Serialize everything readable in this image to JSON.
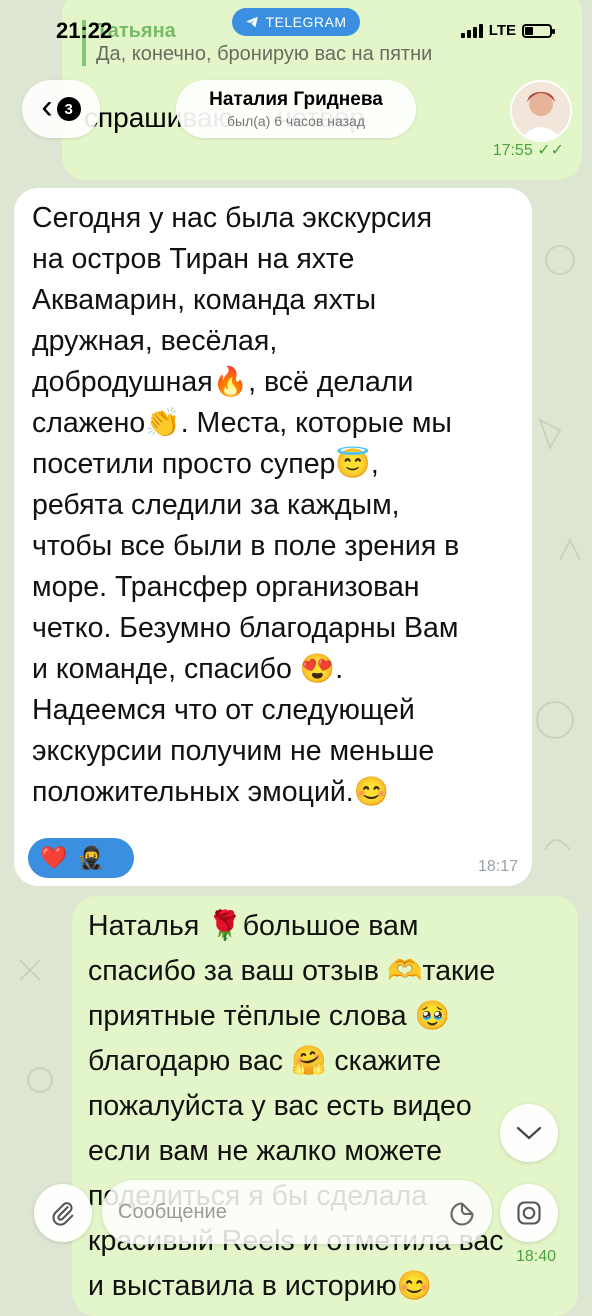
{
  "status_bar": {
    "time": "21:22",
    "app_pill": "TELEGRAM",
    "network": "LTE",
    "battery_level": 0.3
  },
  "header": {
    "back_badge": "3",
    "contact_name": "Наталия Гриднева",
    "contact_status": "был(а) 6 часов назад"
  },
  "previous_message": {
    "reply_name": "Татьяна",
    "reply_text": "Да, конечно, бронирую вас на пятни",
    "text": "спрашиваю … четвер",
    "time": "17:55"
  },
  "incoming_message": {
    "text": "Сегодня у нас была экскурсия\nна остров Тиран на яхте\nАквамарин, команда яхты\nдружная, весёлая,\nдобродушная🔥,  всё делали\nслажено👏. Места, которые мы\nпосетили просто супер😇,\nребята следили за каждым,\nчтобы все были в поле зрения в\nморе. Трансфер организован\nчетко. Безумно благодарны Вам\nи команде, спасибо 😍.\nНадеемся что от следующей\nэкскурсии получим не меньше\nположительных эмоций.😊",
    "reactions": [
      "❤️",
      "🥷"
    ],
    "time": "18:17"
  },
  "outgoing_message": {
    "text": "Наталья 🌹большое вам\nспасибо за ваш отзыв 🫶такие\nприятные тёплые слова 🥹\nблагодарю вас 🤗 скажите\nпожалуйста у вас есть видео\nесли вам не жалко можете\nподелиться я бы сделала\nкрасивый Reels и отметила вас\nи выставила в историю😊",
    "time": "18:40"
  },
  "input": {
    "placeholder": "Сообщение"
  },
  "icons": {
    "attach": "paperclip-icon",
    "sticker": "sticker-icon",
    "camera": "camera-icon",
    "scroll": "chevron-down-icon",
    "back": "chevron-left-icon"
  },
  "colors": {
    "accent": "#3a8fe0",
    "outgoing_bubble": "#e3f6c9",
    "incoming_bubble": "#ffffff",
    "green_text": "#4aa33e"
  }
}
